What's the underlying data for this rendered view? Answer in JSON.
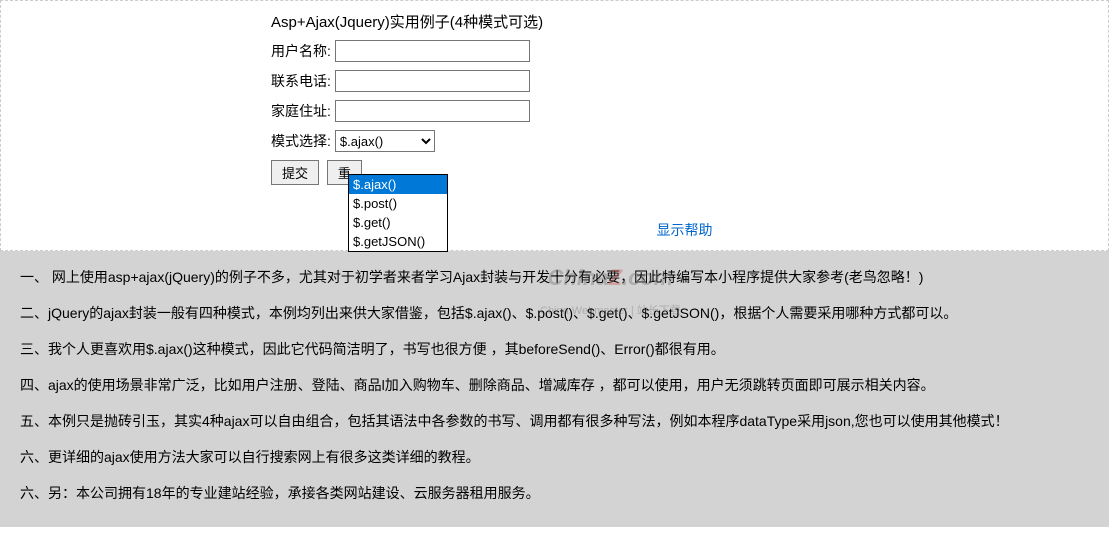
{
  "form": {
    "title": "Asp+Ajax(Jquery)实用例子(4种模式可选)",
    "username_label": "用户名称:",
    "username_value": "",
    "phone_label": "联系电话:",
    "phone_value": "",
    "address_label": "家庭住址:",
    "address_value": "",
    "mode_label": "模式选择:",
    "mode_selected": "$.ajax()",
    "mode_options": [
      "$.ajax()",
      "$.post()",
      "$.get()",
      "$.getJSON()"
    ],
    "submit_label": "提交",
    "reset_label": "重"
  },
  "help_link": "显示帮助",
  "help_items": [
    "一、 网上使用asp+ajax(jQuery)的例子不多，尤其对于初学者来者学习Ajax封装与开发十分有必要，因此特编写本小程序提供大家参考(老鸟忽略！)",
    "二、jQuery的ajax封装一般有四种模式，本例均列出来供大家借鉴，包括$.ajax()、$.post()、$.get()、$.getJSON()，根据个人需要采用哪种方式都可以。",
    "三、我个人更喜欢用$.ajax()这种模式，因此它代码简洁明了，书写也很方便 ，其beforeSend()、Error()都很有用。",
    "四、ajax的使用场景非常广泛，比如用户注册、登陆、商品l加入购物车、删除商品、增减库存 ，都可以使用，用户无须跳转页面即可展示相关内容。",
    "五、本例只是抛砖引玉，其实4种ajax可以自由组合，包括其语法中各参数的书写、调用都有很多种写法，例如本程序dataType采用json,您也可以使用其他模式！",
    "六、更详细的ajax使用方法大家可以自行搜索网上有很多这类详细的教程。",
    "六、另：本公司拥有18年的专业建站经验，承接各类网站建设、云服务器租用服务。"
  ],
  "watermark": {
    "logo_prefix": "China",
    "logo_z": "Z",
    "logo_suffix": ".com",
    "subtitle": "China Webmaster | 站长下载"
  }
}
